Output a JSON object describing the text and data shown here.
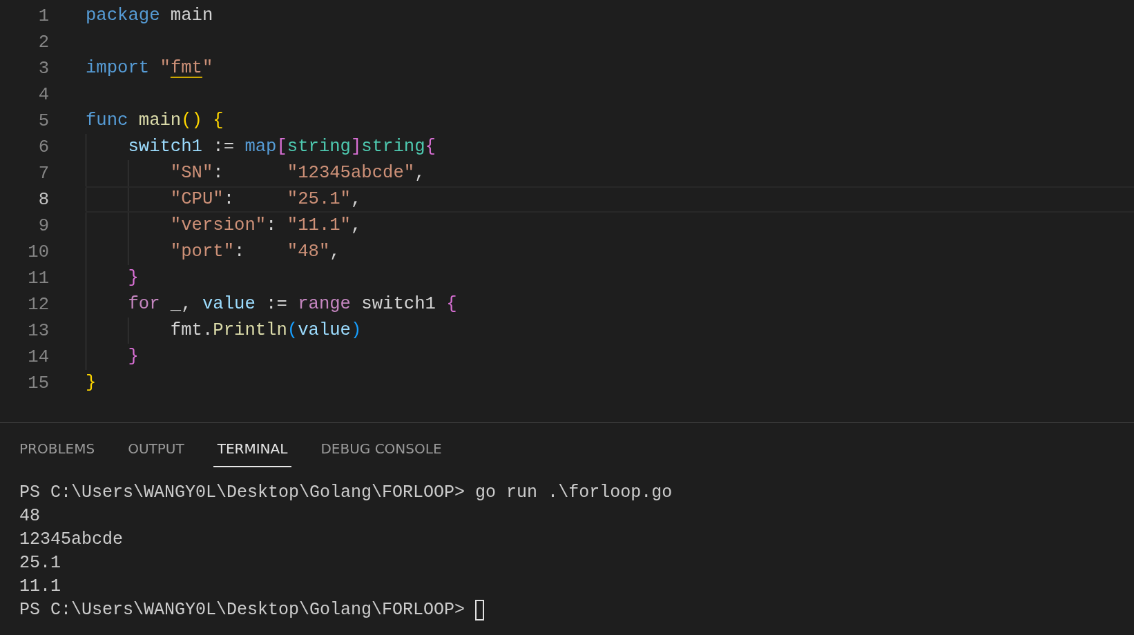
{
  "editor": {
    "lines": [
      {
        "number": "1",
        "current": false,
        "tokens": [
          {
            "text": "package",
            "kind": "keyword"
          },
          {
            "text": " main",
            "kind": "plain"
          }
        ]
      },
      {
        "number": "2",
        "current": false
      },
      {
        "number": "3",
        "current": false,
        "tokens": [
          {
            "text": "import",
            "kind": "keyword"
          },
          {
            "text": " \"",
            "kind": "string"
          },
          {
            "text": "fmt",
            "kind": "string",
            "underlined": true
          },
          {
            "text": "\"",
            "kind": "string"
          }
        ]
      },
      {
        "number": "4",
        "current": false
      },
      {
        "number": "5",
        "current": false,
        "tokens": [
          {
            "text": "func",
            "kind": "keyword"
          },
          {
            "text": " main",
            "kind": "func"
          },
          {
            "text": "() {",
            "kind": "bracket1"
          }
        ]
      },
      {
        "number": "6",
        "current": false,
        "tokens": [
          {
            "text": "    switch1",
            "kind": "variable"
          },
          {
            "text": " := ",
            "kind": "plain"
          },
          {
            "text": "map",
            "kind": "keyword"
          },
          {
            "text": "[",
            "kind": "bracket2"
          },
          {
            "text": "string",
            "kind": "type"
          },
          {
            "text": "]",
            "kind": "bracket2"
          },
          {
            "text": "string",
            "kind": "type"
          },
          {
            "text": "{",
            "kind": "bracket2"
          }
        ]
      },
      {
        "number": "7",
        "current": false,
        "tokens": [
          {
            "text": "        \"SN\"",
            "kind": "string"
          },
          {
            "text": ":      ",
            "kind": "plain"
          },
          {
            "text": "\"12345abcde\"",
            "kind": "string"
          },
          {
            "text": ",",
            "kind": "plain"
          }
        ]
      },
      {
        "number": "8",
        "current": true,
        "tokens": [
          {
            "text": "        \"CPU\"",
            "kind": "string"
          },
          {
            "text": ":     ",
            "kind": "plain"
          },
          {
            "text": "\"25.1\"",
            "kind": "string"
          },
          {
            "text": ",",
            "kind": "plain"
          }
        ]
      },
      {
        "number": "9",
        "current": false,
        "tokens": [
          {
            "text": "        \"version\"",
            "kind": "string"
          },
          {
            "text": ": ",
            "kind": "plain"
          },
          {
            "text": "\"11.1\"",
            "kind": "string"
          },
          {
            "text": ",",
            "kind": "plain"
          }
        ]
      },
      {
        "number": "10",
        "current": false,
        "tokens": [
          {
            "text": "        \"port\"",
            "kind": "string"
          },
          {
            "text": ":    ",
            "kind": "plain"
          },
          {
            "text": "\"48\"",
            "kind": "string"
          },
          {
            "text": ",",
            "kind": "plain"
          }
        ]
      },
      {
        "number": "11",
        "current": false,
        "tokens": [
          {
            "text": "    }",
            "kind": "bracket2"
          }
        ]
      },
      {
        "number": "12",
        "current": false,
        "tokens": [
          {
            "text": "    for",
            "kind": "control"
          },
          {
            "text": " _, ",
            "kind": "plain"
          },
          {
            "text": "value",
            "kind": "variable"
          },
          {
            "text": " := ",
            "kind": "plain"
          },
          {
            "text": "range",
            "kind": "control"
          },
          {
            "text": " switch1 ",
            "kind": "plain"
          },
          {
            "text": "{",
            "kind": "bracket2"
          }
        ]
      },
      {
        "number": "13",
        "current": false,
        "tokens": [
          {
            "text": "        fmt.",
            "kind": "plain"
          },
          {
            "text": "Println",
            "kind": "func"
          },
          {
            "text": "(",
            "kind": "bracket3"
          },
          {
            "text": "value",
            "kind": "variable"
          },
          {
            "text": ")",
            "kind": "bracket3"
          }
        ]
      },
      {
        "number": "14",
        "current": false,
        "tokens": [
          {
            "text": "    }",
            "kind": "bracket2"
          }
        ]
      },
      {
        "number": "15",
        "current": false,
        "tokens": [
          {
            "text": "}",
            "kind": "bracket1"
          }
        ]
      }
    ]
  },
  "panel": {
    "tabs": [
      {
        "label": "PROBLEMS",
        "selected": false
      },
      {
        "label": "OUTPUT",
        "selected": false
      },
      {
        "label": "TERMINAL",
        "selected": true
      },
      {
        "label": "DEBUG CONSOLE",
        "selected": false
      }
    ],
    "terminal": [
      {
        "text": "PS C:\\Users\\WANGY0L\\Desktop\\Golang\\FORLOOP> go run .\\forloop.go",
        "cursor": false
      },
      {
        "text": "48",
        "cursor": false
      },
      {
        "text": "12345abcde",
        "cursor": false
      },
      {
        "text": "25.1",
        "cursor": false
      },
      {
        "text": "11.1",
        "cursor": false
      },
      {
        "text": "PS C:\\Users\\WANGY0L\\Desktop\\Golang\\FORLOOP> ",
        "cursor": true
      }
    ]
  }
}
